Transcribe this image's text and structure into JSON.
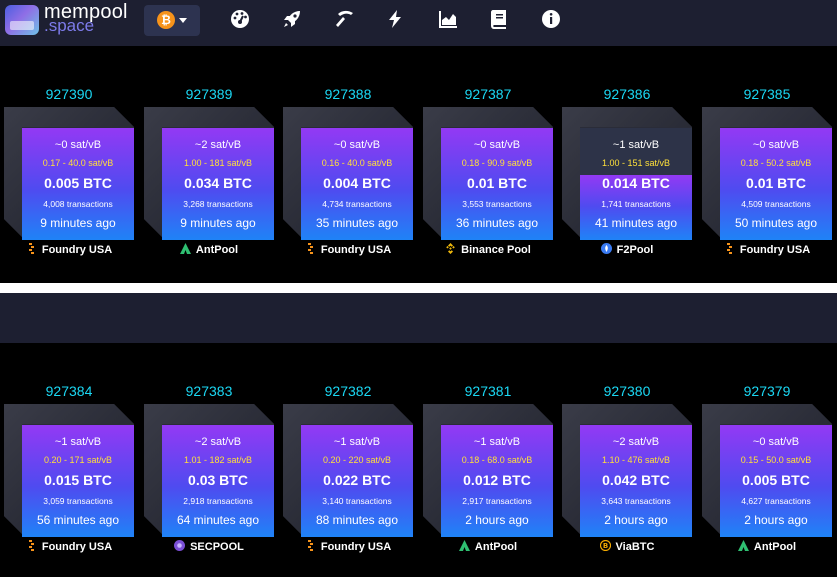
{
  "header": {
    "brand_line1": "mempool",
    "brand_line2": ".space",
    "network_icon": "bitcoin-icon",
    "network_glyph": "₿",
    "nav_icons": [
      "dashboard-gauge-icon",
      "rocket-icon",
      "mining-pickaxe-icon",
      "lightning-bolt-icon",
      "graphs-chart-icon",
      "docs-book-icon",
      "about-info-icon"
    ]
  },
  "colors": {
    "header_bg": "#1d1f31",
    "block_height": "#1bd8f4",
    "fee_range": "#ffe03a",
    "face_top": "#9339f4",
    "face_bottom": "#1f83f7"
  },
  "blocks_row1": [
    {
      "height": "927390",
      "median_fee": "~0 sat/vB",
      "fee_range": "0.17 - 40.0 sat/vB",
      "reward": "0.005 BTC",
      "tx_count": "4,008 transactions",
      "time": "9 minutes ago",
      "pool": "Foundry USA",
      "pool_icon": "foundry-icon"
    },
    {
      "height": "927389",
      "median_fee": "~2 sat/vB",
      "fee_range": "1.00 - 181 sat/vB",
      "reward": "0.034 BTC",
      "tx_count": "3,268 transactions",
      "time": "9 minutes ago",
      "pool": "AntPool",
      "pool_icon": "antpool-icon"
    },
    {
      "height": "927388",
      "median_fee": "~0 sat/vB",
      "fee_range": "0.16 - 40.0 sat/vB",
      "reward": "0.004 BTC",
      "tx_count": "4,734 transactions",
      "time": "35 minutes ago",
      "pool": "Foundry USA",
      "pool_icon": "foundry-icon"
    },
    {
      "height": "927387",
      "median_fee": "~0 sat/vB",
      "fee_range": "0.18 - 90.9 sat/vB",
      "reward": "0.01 BTC",
      "tx_count": "3,553 transactions",
      "time": "36 minutes ago",
      "pool": "Binance Pool",
      "pool_icon": "binance-pool-icon"
    },
    {
      "height": "927386",
      "median_fee": "~1 sat/vB",
      "fee_range": "1.00 - 151 sat/vB",
      "reward": "0.014 BTC",
      "tx_count": "1,741 transactions",
      "time": "41 minutes ago",
      "pool": "F2Pool",
      "pool_icon": "f2pool-icon",
      "partial": true
    },
    {
      "height": "927385",
      "median_fee": "~0 sat/vB",
      "fee_range": "0.18 - 50.2 sat/vB",
      "reward": "0.01 BTC",
      "tx_count": "4,509 transactions",
      "time": "50 minutes ago",
      "pool": "Foundry USA",
      "pool_icon": "foundry-icon"
    }
  ],
  "blocks_row2": [
    {
      "height": "927384",
      "median_fee": "~1 sat/vB",
      "fee_range": "0.20 - 171 sat/vB",
      "reward": "0.015 BTC",
      "tx_count": "3,059 transactions",
      "time": "56 minutes ago",
      "pool": "Foundry USA",
      "pool_icon": "foundry-icon"
    },
    {
      "height": "927383",
      "median_fee": "~2 sat/vB",
      "fee_range": "1.01 - 182 sat/vB",
      "reward": "0.03 BTC",
      "tx_count": "2,918 transactions",
      "time": "64 minutes ago",
      "pool": "SECPOOL",
      "pool_icon": "secpool-icon"
    },
    {
      "height": "927382",
      "median_fee": "~1 sat/vB",
      "fee_range": "0.20 - 220 sat/vB",
      "reward": "0.022 BTC",
      "tx_count": "3,140 transactions",
      "time": "88 minutes ago",
      "pool": "Foundry USA",
      "pool_icon": "foundry-icon"
    },
    {
      "height": "927381",
      "median_fee": "~1 sat/vB",
      "fee_range": "0.18 - 68.0 sat/vB",
      "reward": "0.012 BTC",
      "tx_count": "2,917 transactions",
      "time": "2 hours ago",
      "pool": "AntPool",
      "pool_icon": "antpool-icon"
    },
    {
      "height": "927380",
      "median_fee": "~2 sat/vB",
      "fee_range": "1.10 - 476 sat/vB",
      "reward": "0.042 BTC",
      "tx_count": "3,643 transactions",
      "time": "2 hours ago",
      "pool": "ViaBTC",
      "pool_icon": "viabtc-icon"
    },
    {
      "height": "927379",
      "median_fee": "~0 sat/vB",
      "fee_range": "0.15 - 50.0 sat/vB",
      "reward": "0.005 BTC",
      "tx_count": "4,627 transactions",
      "time": "2 hours ago",
      "pool": "AntPool",
      "pool_icon": "antpool-icon"
    }
  ]
}
